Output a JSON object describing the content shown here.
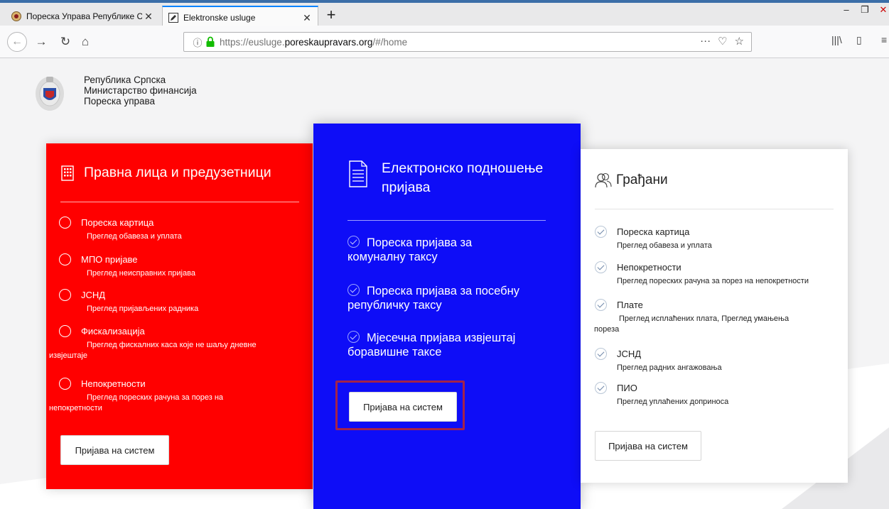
{
  "browser": {
    "tabs": [
      {
        "title": "Пореска Управа Републике С",
        "active": false
      },
      {
        "title": "Elektronske usluge",
        "active": true
      }
    ],
    "url_prefix": "https://eusluge.",
    "url_host": "poreskaupravars.org",
    "url_path": "/#/home",
    "url_menu": "···"
  },
  "header": {
    "line1": "Република Српска",
    "line2": "Министарство финансија",
    "line3": "Пореска управа"
  },
  "legal": {
    "title": "Правна лица и предузетници",
    "items": [
      {
        "label": "Пореска картица",
        "sub": "Преглед обавеза и уплата"
      },
      {
        "label": "МПО пријаве",
        "sub": "Преглед неисправних пријава"
      },
      {
        "label": "ЈСНД",
        "sub": "Преглед пријављених радника"
      },
      {
        "label": "Фискализација",
        "sub_indented": "Преглед фискалних каса које не шаљу дневне",
        "sub_rest": "извјештаје"
      },
      {
        "label": "Непокретности",
        "sub_indented": "Преглед пореских рачуна за порез на",
        "sub_rest": "непокретности"
      }
    ],
    "button": "Пријава на систем"
  },
  "electronic": {
    "title": "Електронско подношење пријава",
    "items": [
      {
        "line1": "Пореска пријава за",
        "line2": "комуналну таксу"
      },
      {
        "line1": "Пореска пријава за посебну",
        "line2": "републичку таксу"
      },
      {
        "line1": "Мјесечна пријава извјештај",
        "line2": "боравишне таксе"
      }
    ],
    "button": "Пријава на систем"
  },
  "citizens": {
    "title": "Грађани",
    "items": [
      {
        "label": "Пореска картица",
        "sub": "Преглед обавеза и уплата"
      },
      {
        "label": "Непокретности",
        "sub": "Преглед пореских рачуна за порез на непокретности"
      },
      {
        "label": "Плате",
        "sub_indented": "Преглед исплаћених плата, Преглед умањења",
        "sub_rest": "пореза"
      },
      {
        "label": "ЈСНД",
        "sub": "Преглед радних ангажовања"
      },
      {
        "label": "ПИО",
        "sub": "Преглед уплаћених доприноса"
      }
    ],
    "button": "Пријава на систем"
  },
  "colors": {
    "red_card": "#ff0000",
    "blue_card": "#0e0df7",
    "highlight": "#a3234a"
  }
}
